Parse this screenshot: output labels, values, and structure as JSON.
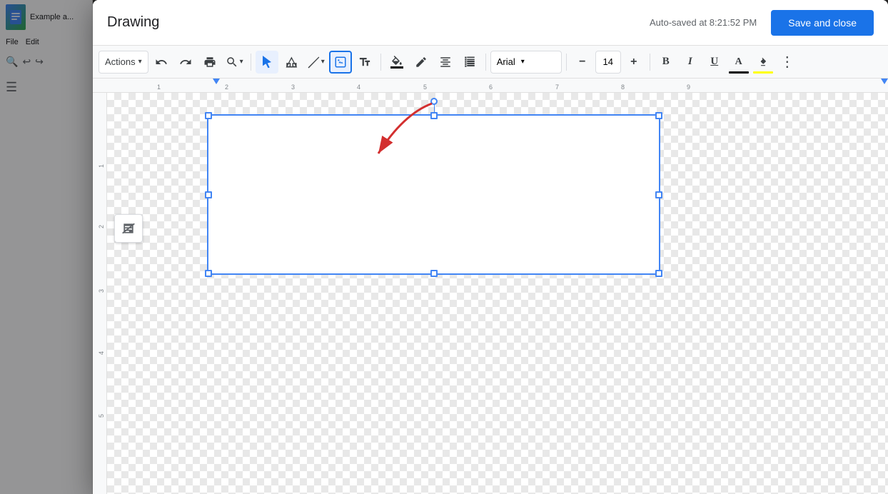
{
  "dialog": {
    "title": "Drawing",
    "autosave": "Auto-saved at 8:21:52 PM",
    "save_close_label": "Save and close"
  },
  "toolbar": {
    "actions_label": "Actions",
    "font_name": "Arial",
    "font_size": "14",
    "more_label": "⋮"
  },
  "doc": {
    "title": "Example a...",
    "file_menu": "File",
    "edit_menu": "Edit"
  },
  "rulers": {
    "horizontal": [
      "1",
      "2",
      "3",
      "4",
      "5",
      "6",
      "7",
      "8",
      "9"
    ],
    "vertical": [
      "1",
      "2",
      "3",
      "4",
      "5"
    ]
  }
}
